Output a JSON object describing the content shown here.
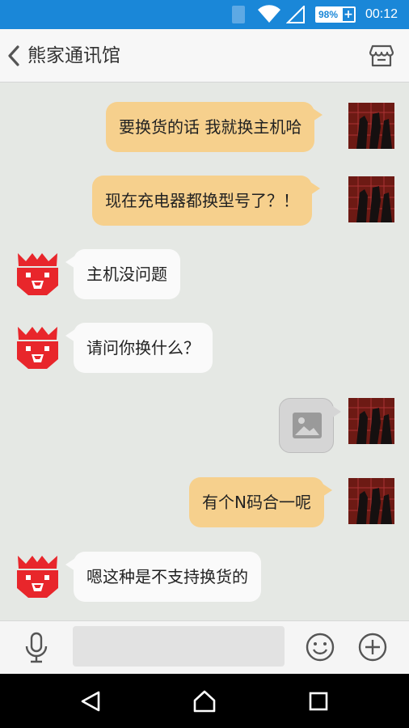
{
  "status_bar": {
    "battery": "98%",
    "time": "00:12",
    "icons": [
      "sim-icon",
      "wifi-icon",
      "signal-icon",
      "battery-icon"
    ]
  },
  "header": {
    "title": "熊家通讯馆",
    "icons": [
      "back-arrow-icon",
      "store-icon"
    ]
  },
  "messages": [
    {
      "side": "out",
      "type": "text",
      "text": "要换货的话 我就换主机哈"
    },
    {
      "side": "out",
      "type": "text",
      "text": "现在充电器都换型号了？！"
    },
    {
      "side": "in",
      "type": "text",
      "text": "主机没问题"
    },
    {
      "side": "in",
      "type": "text",
      "text": "请问你换什么？"
    },
    {
      "side": "out",
      "type": "image",
      "icon": "image-placeholder-icon"
    },
    {
      "side": "out",
      "type": "text",
      "text": "有个N码合一呢"
    },
    {
      "side": "in",
      "type": "text",
      "text": "嗯这种是不支持换货的"
    }
  ],
  "input_bar": {
    "value": "",
    "icons": [
      "microphone-icon",
      "emoji-icon",
      "plus-circle-icon"
    ]
  },
  "nav_bar": {
    "icons": [
      "nav-back-icon",
      "nav-home-icon",
      "nav-recents-icon"
    ]
  },
  "colors": {
    "status_bar": "#1a87d8",
    "chat_background": "#e5e8e4",
    "outgoing_bubble": "#f6d08d",
    "incoming_bubble": "#fafafa",
    "bot_avatar": "#e8262b"
  }
}
